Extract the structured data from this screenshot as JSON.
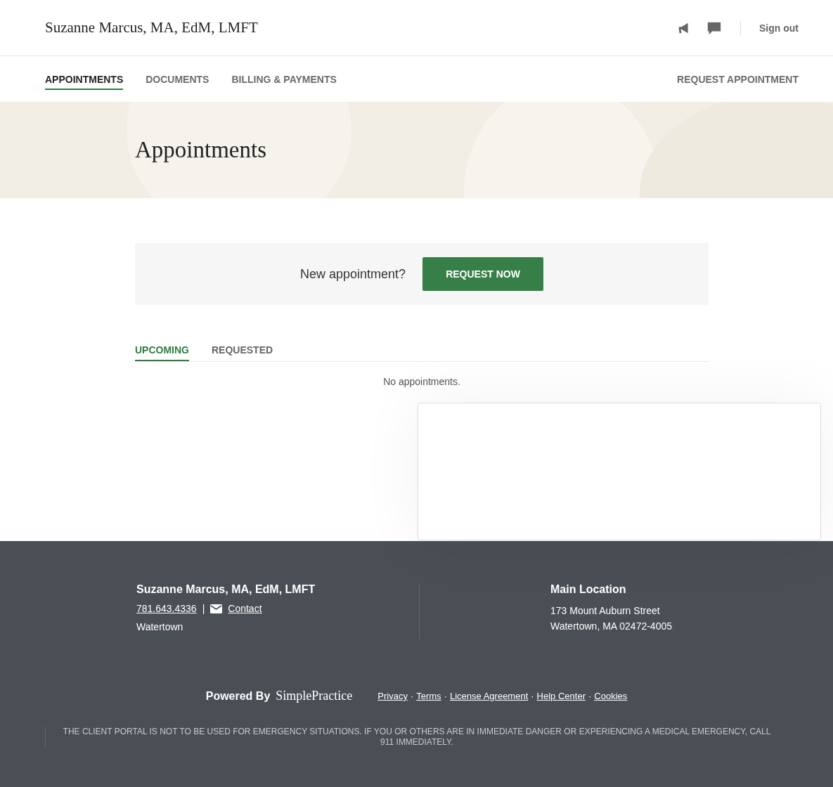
{
  "header": {
    "title": "Suzanne Marcus, MA, EdM, LMFT",
    "sign_out": "Sign out"
  },
  "nav": {
    "items": [
      {
        "label": "APPOINTMENTS",
        "selected": true
      },
      {
        "label": "DOCUMENTS",
        "selected": false
      },
      {
        "label": "BILLING & PAYMENTS",
        "selected": false
      }
    ],
    "request": "REQUEST APPOINTMENT"
  },
  "hero": {
    "title": "Appointments"
  },
  "request_banner": {
    "text": "New appointment?",
    "button": "REQUEST NOW"
  },
  "tabs": [
    {
      "label": "UPCOMING",
      "selected": true
    },
    {
      "label": "REQUESTED",
      "selected": false
    }
  ],
  "empty_message": "No appointments.",
  "footer": {
    "name": "Suzanne Marcus, MA, EdM, LMFT",
    "phone": "781.643.4336",
    "divider": "|",
    "contact": "Contact",
    "city": "Watertown",
    "location": {
      "title": "Main Location",
      "lines": [
        "173 Mount Auburn Street",
        "Watertown, MA 02472-4005"
      ]
    },
    "powered_by": "Powered By",
    "brand": "SimplePractice",
    "separator": "·",
    "links": [
      "Privacy",
      "Terms",
      "License Agreement",
      "Help Center",
      "Cookies"
    ],
    "disclaimer": "THE CLIENT PORTAL IS NOT TO BE USED FOR EMERGENCY SITUATIONS. IF YOU OR OTHERS ARE IN IMMEDIATE DANGER OR EXPERIENCING A MEDICAL EMERGENCY, CALL 911 IMMEDIATELY."
  }
}
